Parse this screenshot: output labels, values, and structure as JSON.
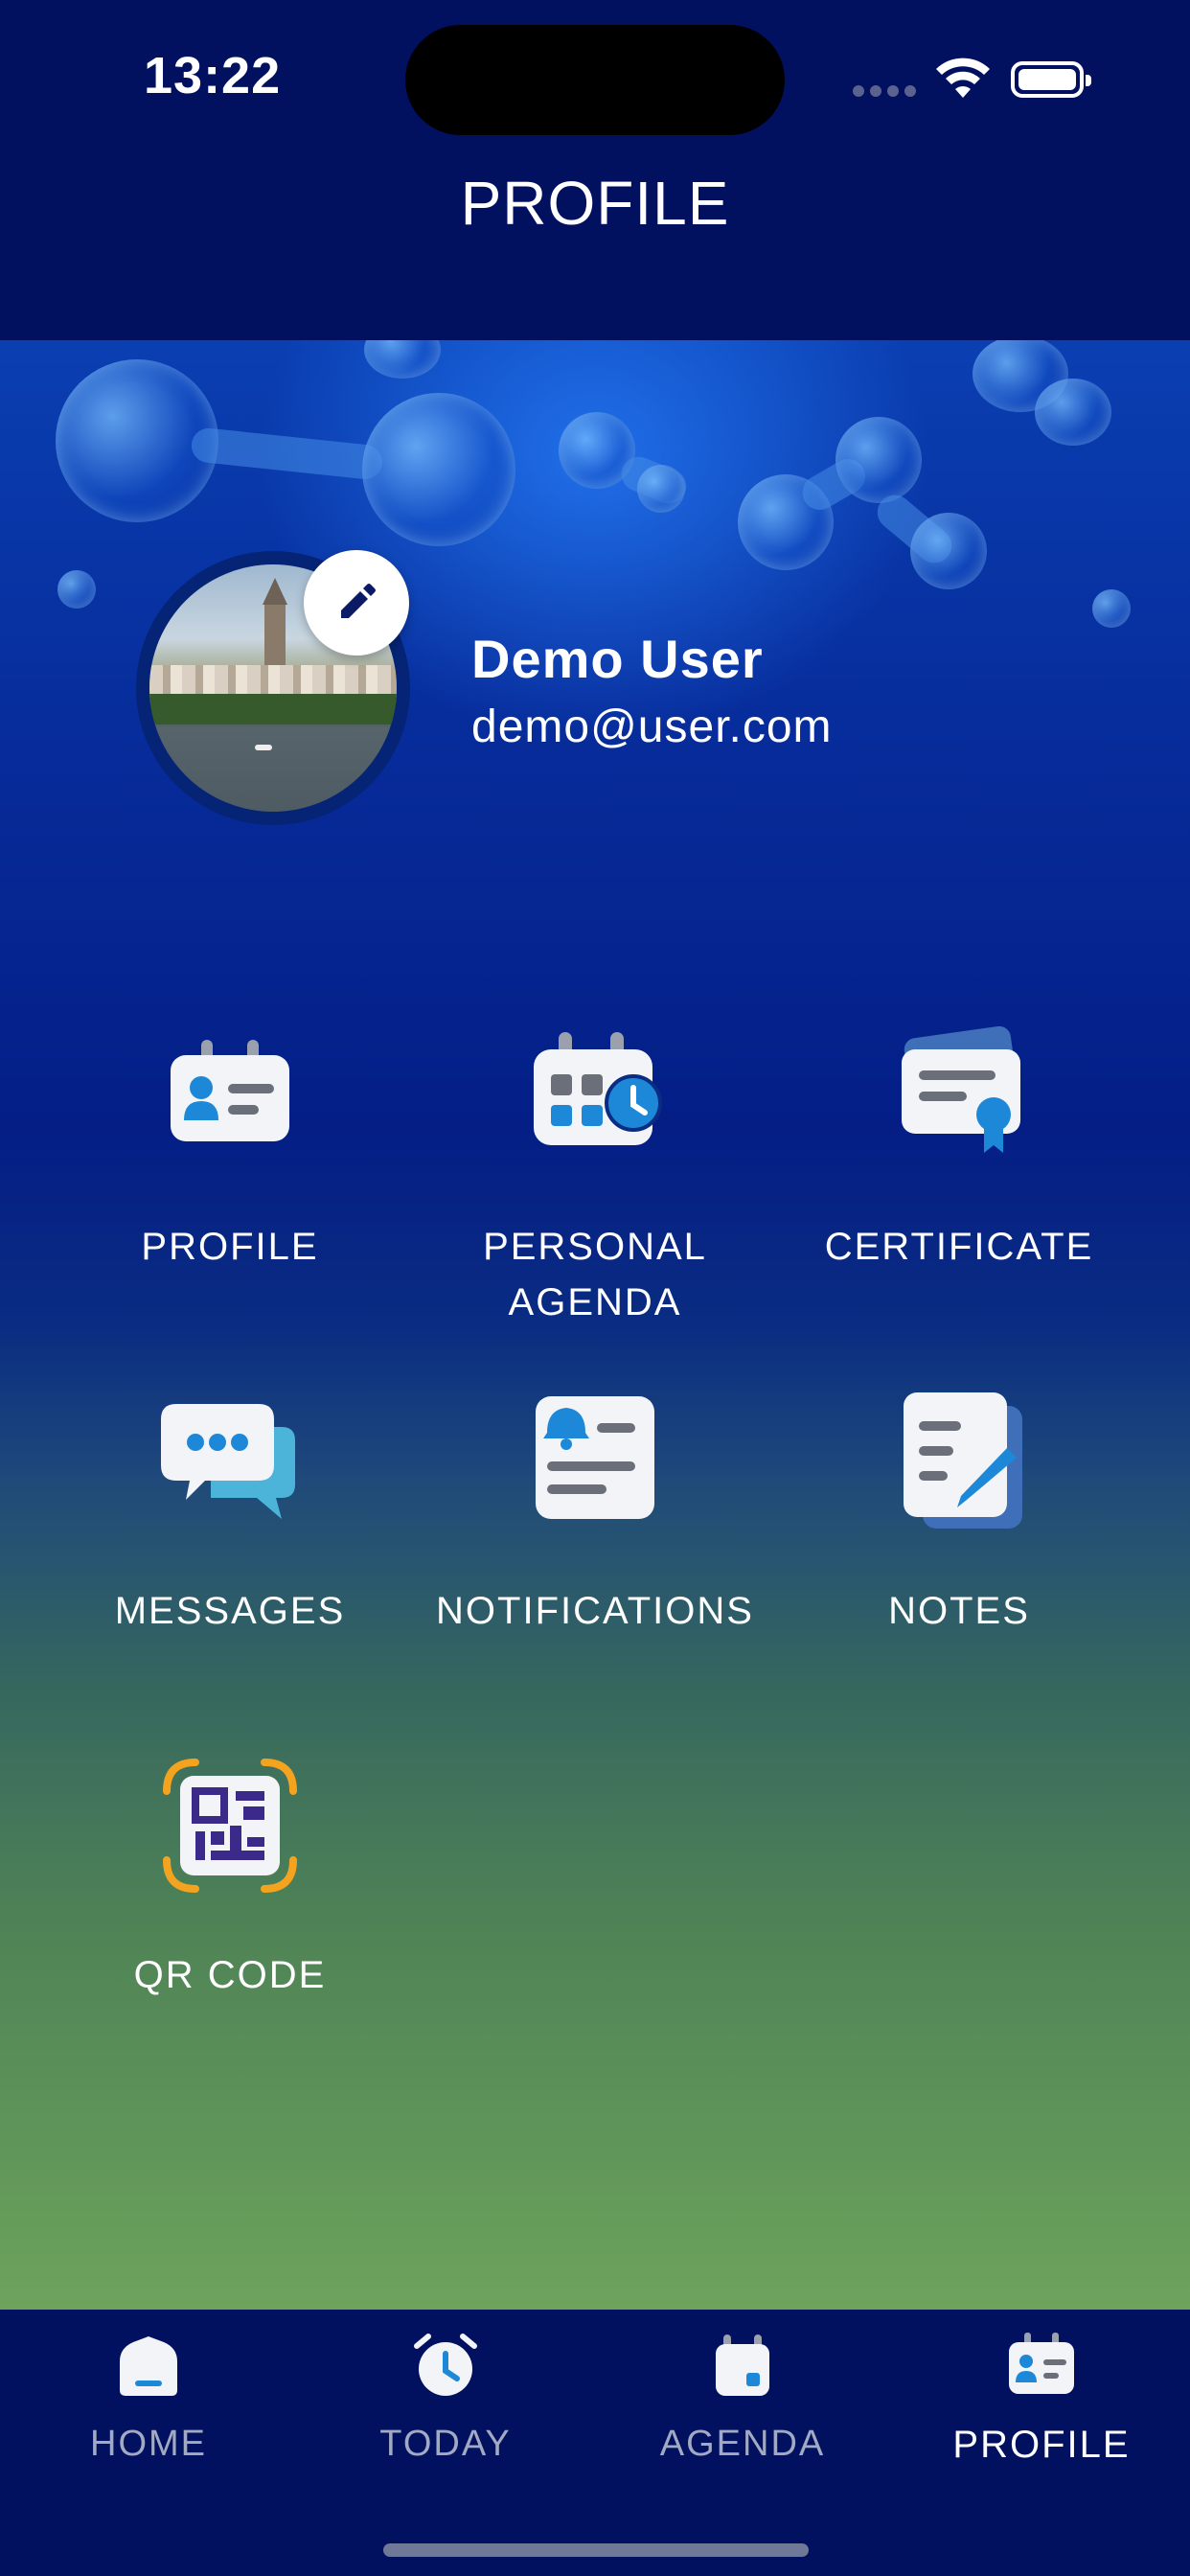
{
  "status_bar": {
    "time": "13:22",
    "icons": [
      "cellular-signal-icon",
      "wifi-icon",
      "battery-icon"
    ]
  },
  "header": {
    "title": "PROFILE"
  },
  "profile": {
    "name": "Demo User",
    "email": "demo@user.com",
    "avatar": "avatar-photo",
    "edit_icon": "pencil-icon"
  },
  "menu": {
    "items": [
      {
        "label": "PROFILE",
        "icon": "id-card-icon"
      },
      {
        "label": "PERSONAL\nAGENDA",
        "icon": "calendar-clock-icon"
      },
      {
        "label": "CERTIFICATE",
        "icon": "certificate-icon"
      },
      {
        "label": "MESSAGES",
        "icon": "chat-bubbles-icon"
      },
      {
        "label": "NOTIFICATIONS",
        "icon": "notification-bell-icon"
      },
      {
        "label": "NOTES",
        "icon": "notes-pen-icon"
      },
      {
        "label": "QR CODE",
        "icon": "qr-code-icon"
      }
    ]
  },
  "tabbar": {
    "tabs": [
      {
        "label": "HOME",
        "icon": "home-icon",
        "active": false
      },
      {
        "label": "TODAY",
        "icon": "alarm-clock-icon",
        "active": false
      },
      {
        "label": "AGENDA",
        "icon": "calendar-icon",
        "active": false
      },
      {
        "label": "PROFILE",
        "icon": "id-card-icon",
        "active": true
      }
    ]
  },
  "colors": {
    "navy": "#021060",
    "accent_blue": "#1e88d8",
    "icon_gray": "#6b6f7a",
    "qr_purple": "#3b2a8a",
    "qr_orange": "#f4a31f"
  }
}
